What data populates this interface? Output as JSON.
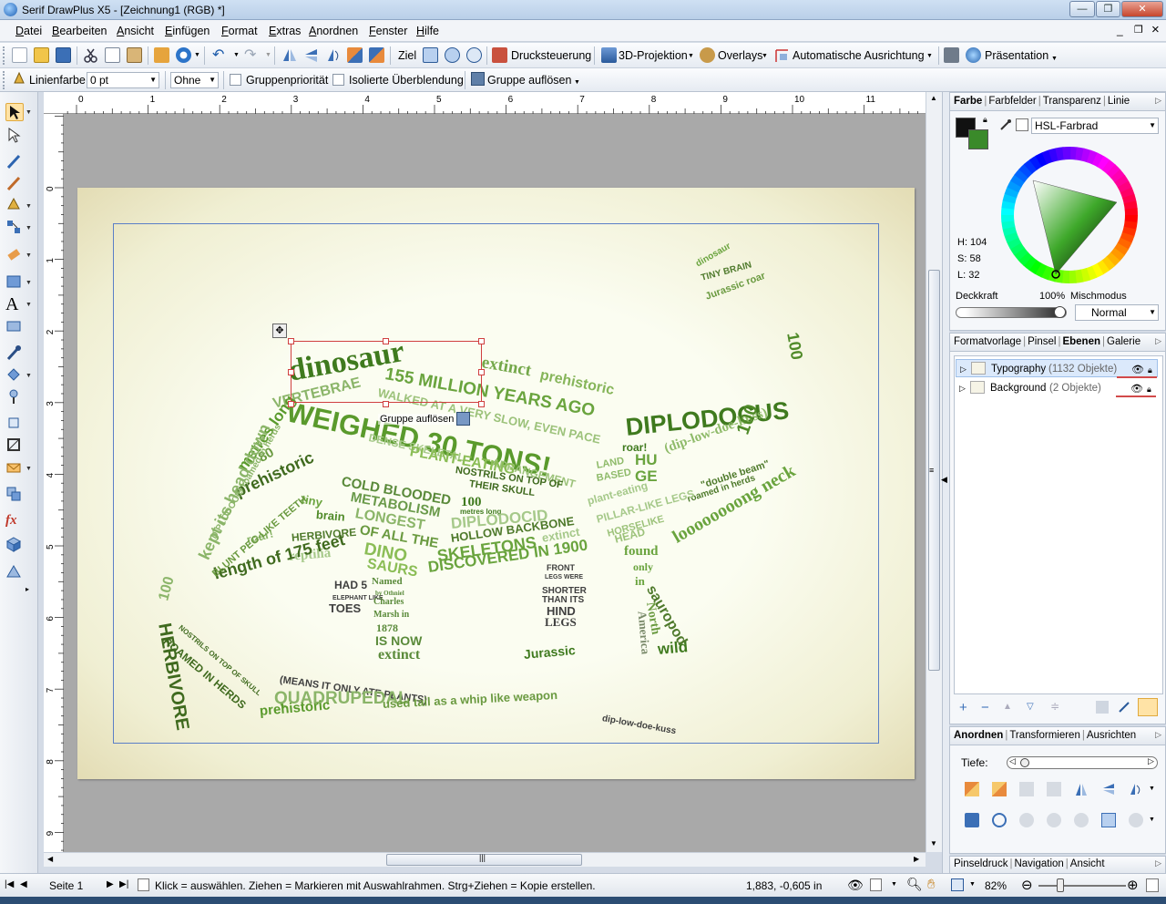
{
  "window": {
    "title": "Serif DrawPlus X5 - [Zeichnung1 (RGB) *]",
    "buttons": {
      "minimize": "—",
      "restore": "❐",
      "close": "✕",
      "mdi_minimize": "_",
      "mdi_restore": "❐",
      "mdi_close": "×"
    }
  },
  "menu": [
    "Datei",
    "Bearbeiten",
    "Ansicht",
    "Einfügen",
    "Format",
    "Extras",
    "Anordnen",
    "Fenster",
    "Hilfe"
  ],
  "toolbar1": {
    "ziel": "Ziel",
    "drucksteuerung": "Drucksteuerung",
    "projektion": "3D-Projektion",
    "overlays": "Overlays",
    "ausrichtung": "Automatische Ausrichtung",
    "praesentation": "Präsentation"
  },
  "toolbar2": {
    "linienfarbe": "Linienfarbe",
    "line_width": "0 pt",
    "line_style": "Ohne",
    "gruppenprioritaet": "Gruppenpriorität",
    "isolierte": "Isolierte Überblendung",
    "gruppe_aufloesen": "Gruppe auflösen"
  },
  "ruler": {
    "unit": "in",
    "top_ticks": [
      "0",
      "1",
      "2",
      "3",
      "4",
      "5",
      "6",
      "7",
      "8",
      "9",
      "10",
      "11"
    ],
    "left_ticks": [
      "0",
      "1",
      "2",
      "3",
      "4",
      "5",
      "6",
      "7",
      "8",
      "9"
    ]
  },
  "canvas": {
    "tooltip": "Gruppe auflösen",
    "artwork_words": [
      "dinosaur",
      "extinct",
      "prehistoric",
      "155 MILLION YEARS AGO",
      "VERTEBRAE",
      "WALKED AT A VERY SLOW, EVEN PACE",
      "WEIGHED 30 TONS!",
      "roar!",
      "DIPLODOCUS",
      "(dip-low-doe-kuss)",
      "100",
      "prehistoric",
      "80",
      "metres long",
      "DENSE SKELETAL",
      "ARRANGEMENT",
      "PLANT-EATING",
      "COLD BLOODED",
      "METABOLISM",
      "NOSTRILS ON TOP OF",
      "THEIR SKULL",
      "LONGEST",
      "OF ALL THE",
      "DINO",
      "SAURS",
      "100",
      "metres long",
      "DIPLODOCID",
      "HOLLOW BACKBONE",
      "tiny",
      "brain",
      "roar!",
      "HERBIVORE",
      "reptilia",
      "length of 175 feet",
      "SKELETONS",
      "DISCOVERED IN 1900",
      "extinct",
      "HAD 5",
      "ELEPHANT LIKE",
      "TOES",
      "Named",
      "by Othniel",
      "Charles",
      "Marsh in",
      "1878",
      "IS NOW",
      "extinct",
      "FRONT",
      "LEGS WERE",
      "SHORTER",
      "THAN ITS",
      "HIND",
      "LEGS",
      "Jurassic",
      "wild",
      "sauropod",
      "North",
      "America",
      "found",
      "only",
      "in",
      "loooooooong neck",
      "\"double beam\"",
      "roamed in herds",
      "plant-eating",
      "PILLAR-LIKE LEGS",
      "HORSELIKE",
      "HEAD",
      "HU",
      "GE",
      "LAND",
      "BASED",
      "HERBIVORE",
      "(MEANS IT ONLY ATE PLANTS)",
      "QUADRUPEDAL",
      "prehistoric",
      "used tail as a whip like weapon",
      "dip-low-doe-kuss",
      "ROAMED IN HERDS",
      "NOSTRILS ON TOP OF SKULL",
      "kept its head down",
      "BLUNT PEG-LIKE TEETH",
      "DIPLODOCID roamed in herds",
      "100",
      "dinosaur",
      "TINY BRAIN",
      "100",
      "Jurassic roar"
    ]
  },
  "panel_color": {
    "tabs": [
      "Farbe",
      "Farbfelder",
      "Transparenz",
      "Linie"
    ],
    "mode": "HSL-Farbrad",
    "h": "H: 104",
    "s": "S: 58",
    "l": "L: 32",
    "deckkraft_label": "Deckkraft",
    "deckkraft_value": "100%",
    "mischmodus_label": "Mischmodus",
    "mischmodus_value": "Normal",
    "fill_color": "#3a8a2a"
  },
  "panel_layers": {
    "tabs": [
      "Formatvorlage",
      "Pinsel",
      "Ebenen",
      "Galerie"
    ],
    "layers": [
      {
        "name": "Typography",
        "count": "(1132 Objekte)"
      },
      {
        "name": "Background",
        "count": "(2 Objekte)"
      }
    ]
  },
  "panel_arrange": {
    "tabs": [
      "Anordnen",
      "Transformieren",
      "Ausrichten"
    ],
    "tiefe": "Tiefe:"
  },
  "panel_bottom": {
    "tabs": [
      "Pinseldruck",
      "Navigation",
      "Ansicht"
    ]
  },
  "statusbar": {
    "page": "Seite 1",
    "hint": "Klick = auswählen. Ziehen = Markieren mit  Auswahlrahmen. Strg+Ziehen = Kopie erstellen.",
    "coords": "1,883, -0,605 in",
    "zoom": "82%"
  }
}
